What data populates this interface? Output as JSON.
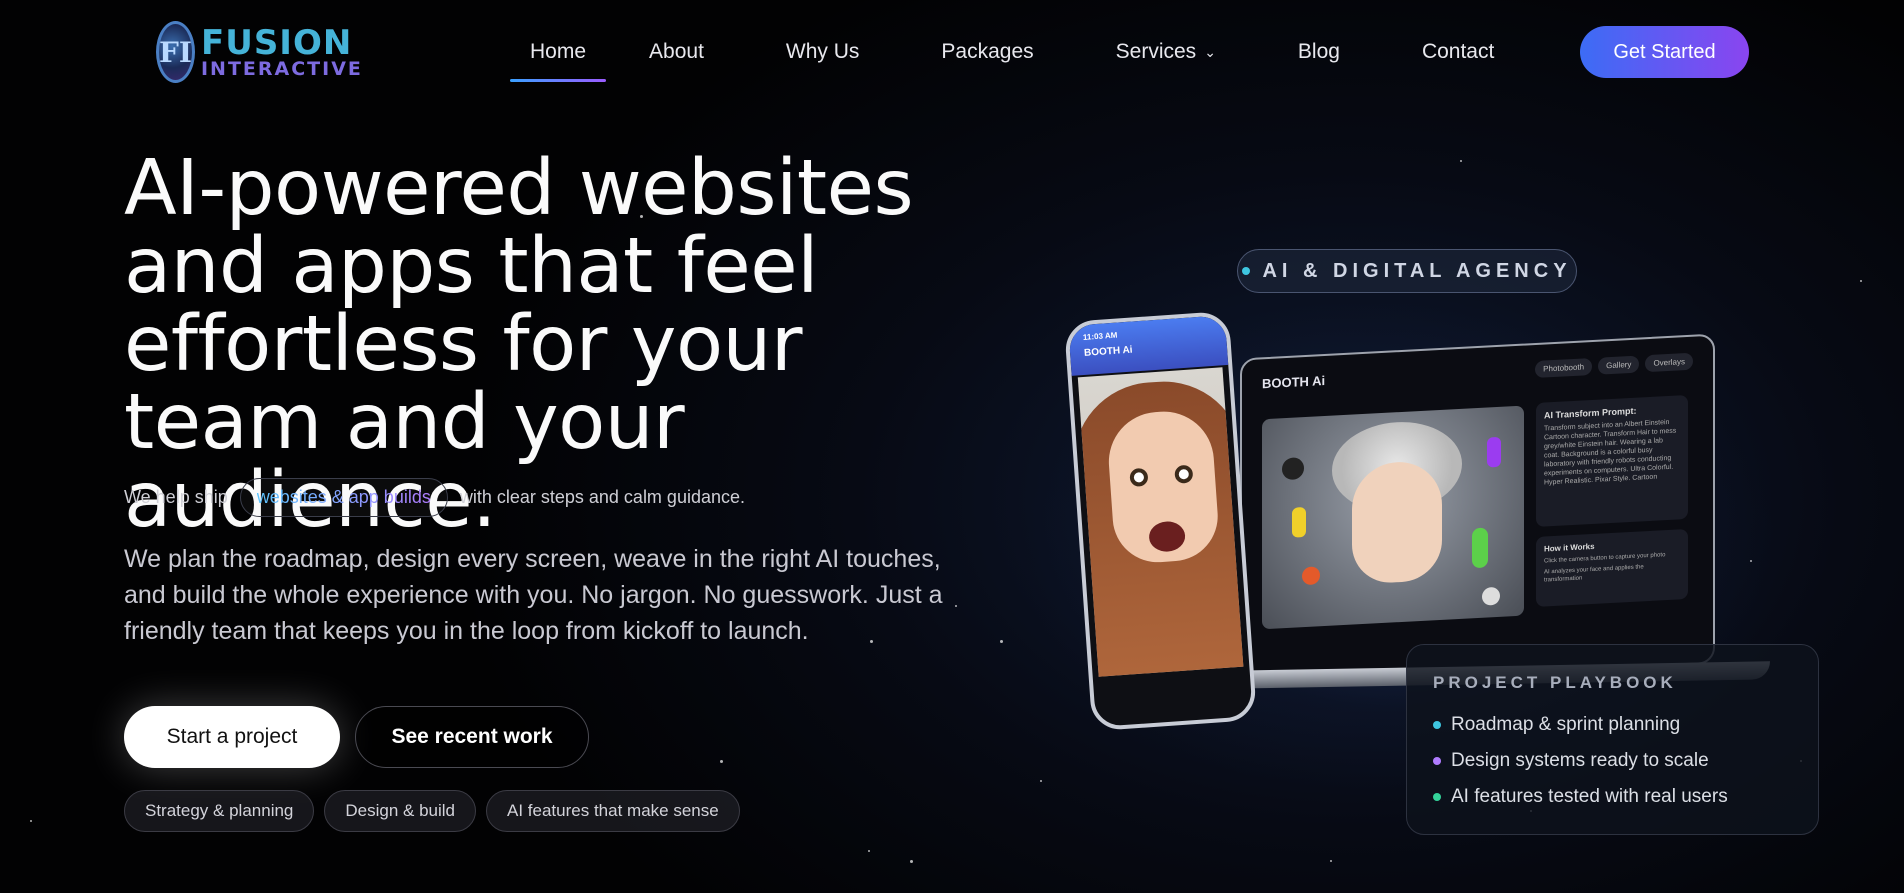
{
  "brand": {
    "line1": "FUSION",
    "line2": "INTERACTIVE",
    "mark": "FI"
  },
  "nav": {
    "links": [
      {
        "label": "Home"
      },
      {
        "label": "About"
      },
      {
        "label": "Why Us"
      },
      {
        "label": "Packages"
      },
      {
        "label": "Services"
      },
      {
        "label": "Blog"
      },
      {
        "label": "Contact"
      }
    ],
    "cta": "Get Started"
  },
  "hero": {
    "title": "AI-powered websites and apps that feel effortless for your team and your audience.",
    "ship_prefix": "We help ship",
    "ship_pill": "websites & app builds",
    "ship_suffix": "with clear steps and calm guidance.",
    "description": "We plan the roadmap, design every screen, weave in the right AI touches, and build the whole experience with you. No jargon. No guesswork. Just a friendly team that keeps you in the loop from kickoff to launch.",
    "primary_button": "Start a project",
    "secondary_button": "See recent work",
    "tags": [
      "Strategy & planning",
      "Design & build",
      "AI features that make sense"
    ]
  },
  "visual": {
    "agency_label": "AI & DIGITAL AGENCY",
    "laptop": {
      "brand": "BOOTH Ai",
      "tabs": [
        "Photobooth",
        "Gallery",
        "Overlays"
      ],
      "prompt_title": "AI Transform Prompt:",
      "prompt_text": "Transform subject into an Albert Einstein Cartoon character. Transform Hair to mess grey/white Einstein hair. Wearing a lab coat. Background is a colorful busy laboratory with friendly robots conducting experiments on computers. Ultra Colorful. Hyper Realistic. Pixar Style. Cartoon",
      "how_title": "How it Works",
      "how_steps": [
        "Click the camera button to capture your photo",
        "AI analyzes your face and applies the transformation"
      ]
    },
    "phone": {
      "time": "11:03 AM",
      "brand": "BOOTH Ai"
    }
  },
  "playbook": {
    "title": "PROJECT PLAYBOOK",
    "items": [
      {
        "label": "Roadmap & sprint planning",
        "color": "#3ec6e0"
      },
      {
        "label": "Design systems ready to scale",
        "color": "#b07cff"
      },
      {
        "label": "AI features tested with real users",
        "color": "#34d39a"
      }
    ]
  },
  "colors": {
    "accent_start": "#3c6cf5",
    "accent_end": "#8a45f0"
  }
}
